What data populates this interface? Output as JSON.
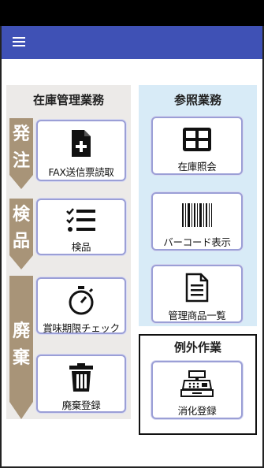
{
  "appbar": {
    "menu_icon": "hamburger-menu-icon",
    "color": "#3f51b5"
  },
  "inventory": {
    "title": "在庫管理業務",
    "steps": [
      {
        "label": "発注",
        "chars": [
          "発",
          "注"
        ]
      },
      {
        "label": "検品",
        "chars": [
          "検",
          "品"
        ]
      },
      {
        "label": "廃棄",
        "chars": [
          "廃",
          "棄"
        ]
      }
    ],
    "tiles": [
      {
        "label": "FAX送信票読取",
        "icon": "fax-document-add-icon"
      },
      {
        "label": "検品",
        "icon": "checklist-icon"
      },
      {
        "label": "賞味期限チェック",
        "icon": "stopwatch-icon"
      },
      {
        "label": "廃棄登録",
        "icon": "trash-icon"
      }
    ]
  },
  "reference": {
    "title": "参照業務",
    "tiles": [
      {
        "label": "在庫照会",
        "icon": "grid-table-icon"
      },
      {
        "label": "バーコード表示",
        "icon": "barcode-icon"
      },
      {
        "label": "管理商品一覧",
        "icon": "document-list-icon"
      }
    ]
  },
  "exception": {
    "title": "例外作業",
    "tiles": [
      {
        "label": "消化登録",
        "icon": "cash-register-icon"
      }
    ]
  },
  "colors": {
    "left_panel": "#eceae8",
    "right_panel": "#d8ebf7",
    "arrow": "#a89478",
    "tile_border": "#9b9fd6"
  }
}
